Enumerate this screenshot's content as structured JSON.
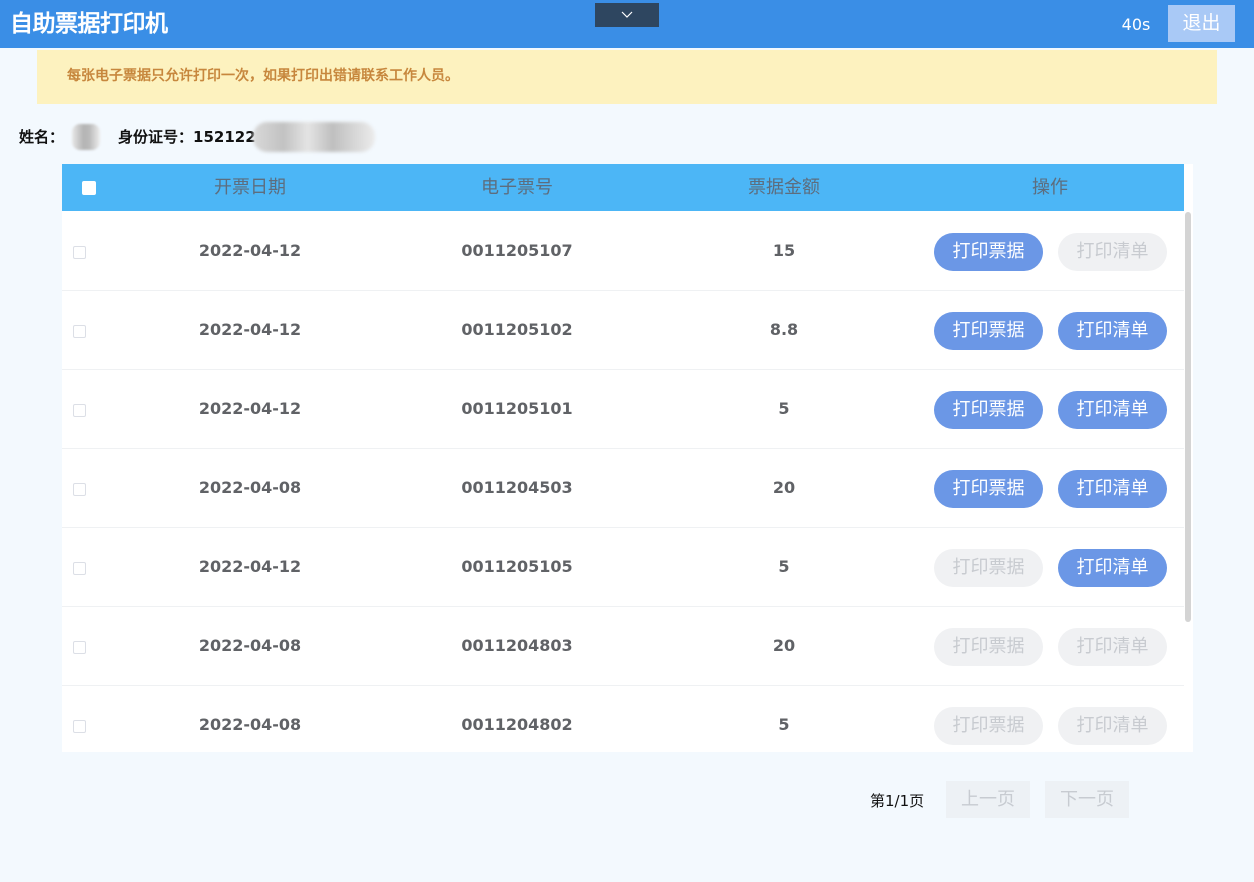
{
  "header": {
    "title": "自助票据打印机",
    "countdown": "40s",
    "exit_label": "退出",
    "toggle_icon": "chevron-down-icon"
  },
  "notice": {
    "text": "每张电子票据只允许打印一次，如果打印出错请联系工作人员。"
  },
  "user": {
    "name_label": "姓名：",
    "id_label": "身份证号：",
    "id_prefix": "152122"
  },
  "table": {
    "columns": [
      "开票日期",
      "电子票号",
      "票据金额",
      "操作"
    ],
    "rows": [
      {
        "date": "2022-04-12",
        "number": "0011205107",
        "amount": "15",
        "receipt_enabled": true,
        "list_enabled": false
      },
      {
        "date": "2022-04-12",
        "number": "0011205102",
        "amount": "8.8",
        "receipt_enabled": true,
        "list_enabled": true
      },
      {
        "date": "2022-04-12",
        "number": "0011205101",
        "amount": "5",
        "receipt_enabled": true,
        "list_enabled": true
      },
      {
        "date": "2022-04-08",
        "number": "0011204503",
        "amount": "20",
        "receipt_enabled": true,
        "list_enabled": true
      },
      {
        "date": "2022-04-12",
        "number": "0011205105",
        "amount": "5",
        "receipt_enabled": false,
        "list_enabled": true
      },
      {
        "date": "2022-04-08",
        "number": "0011204803",
        "amount": "20",
        "receipt_enabled": false,
        "list_enabled": false
      },
      {
        "date": "2022-04-08",
        "number": "0011204802",
        "amount": "5",
        "receipt_enabled": false,
        "list_enabled": false
      }
    ],
    "print_receipt_label": "打印票据",
    "print_list_label": "打印清单"
  },
  "pagination": {
    "info": "第1/1页",
    "prev_label": "上一页",
    "next_label": "下一页"
  },
  "colors": {
    "header_bg": "#3a8ee6",
    "table_header_bg": "#4cb6f6",
    "active_button": "#6b97e6",
    "notice_bg": "#fdf2bf",
    "notice_text": "#c7873d"
  }
}
